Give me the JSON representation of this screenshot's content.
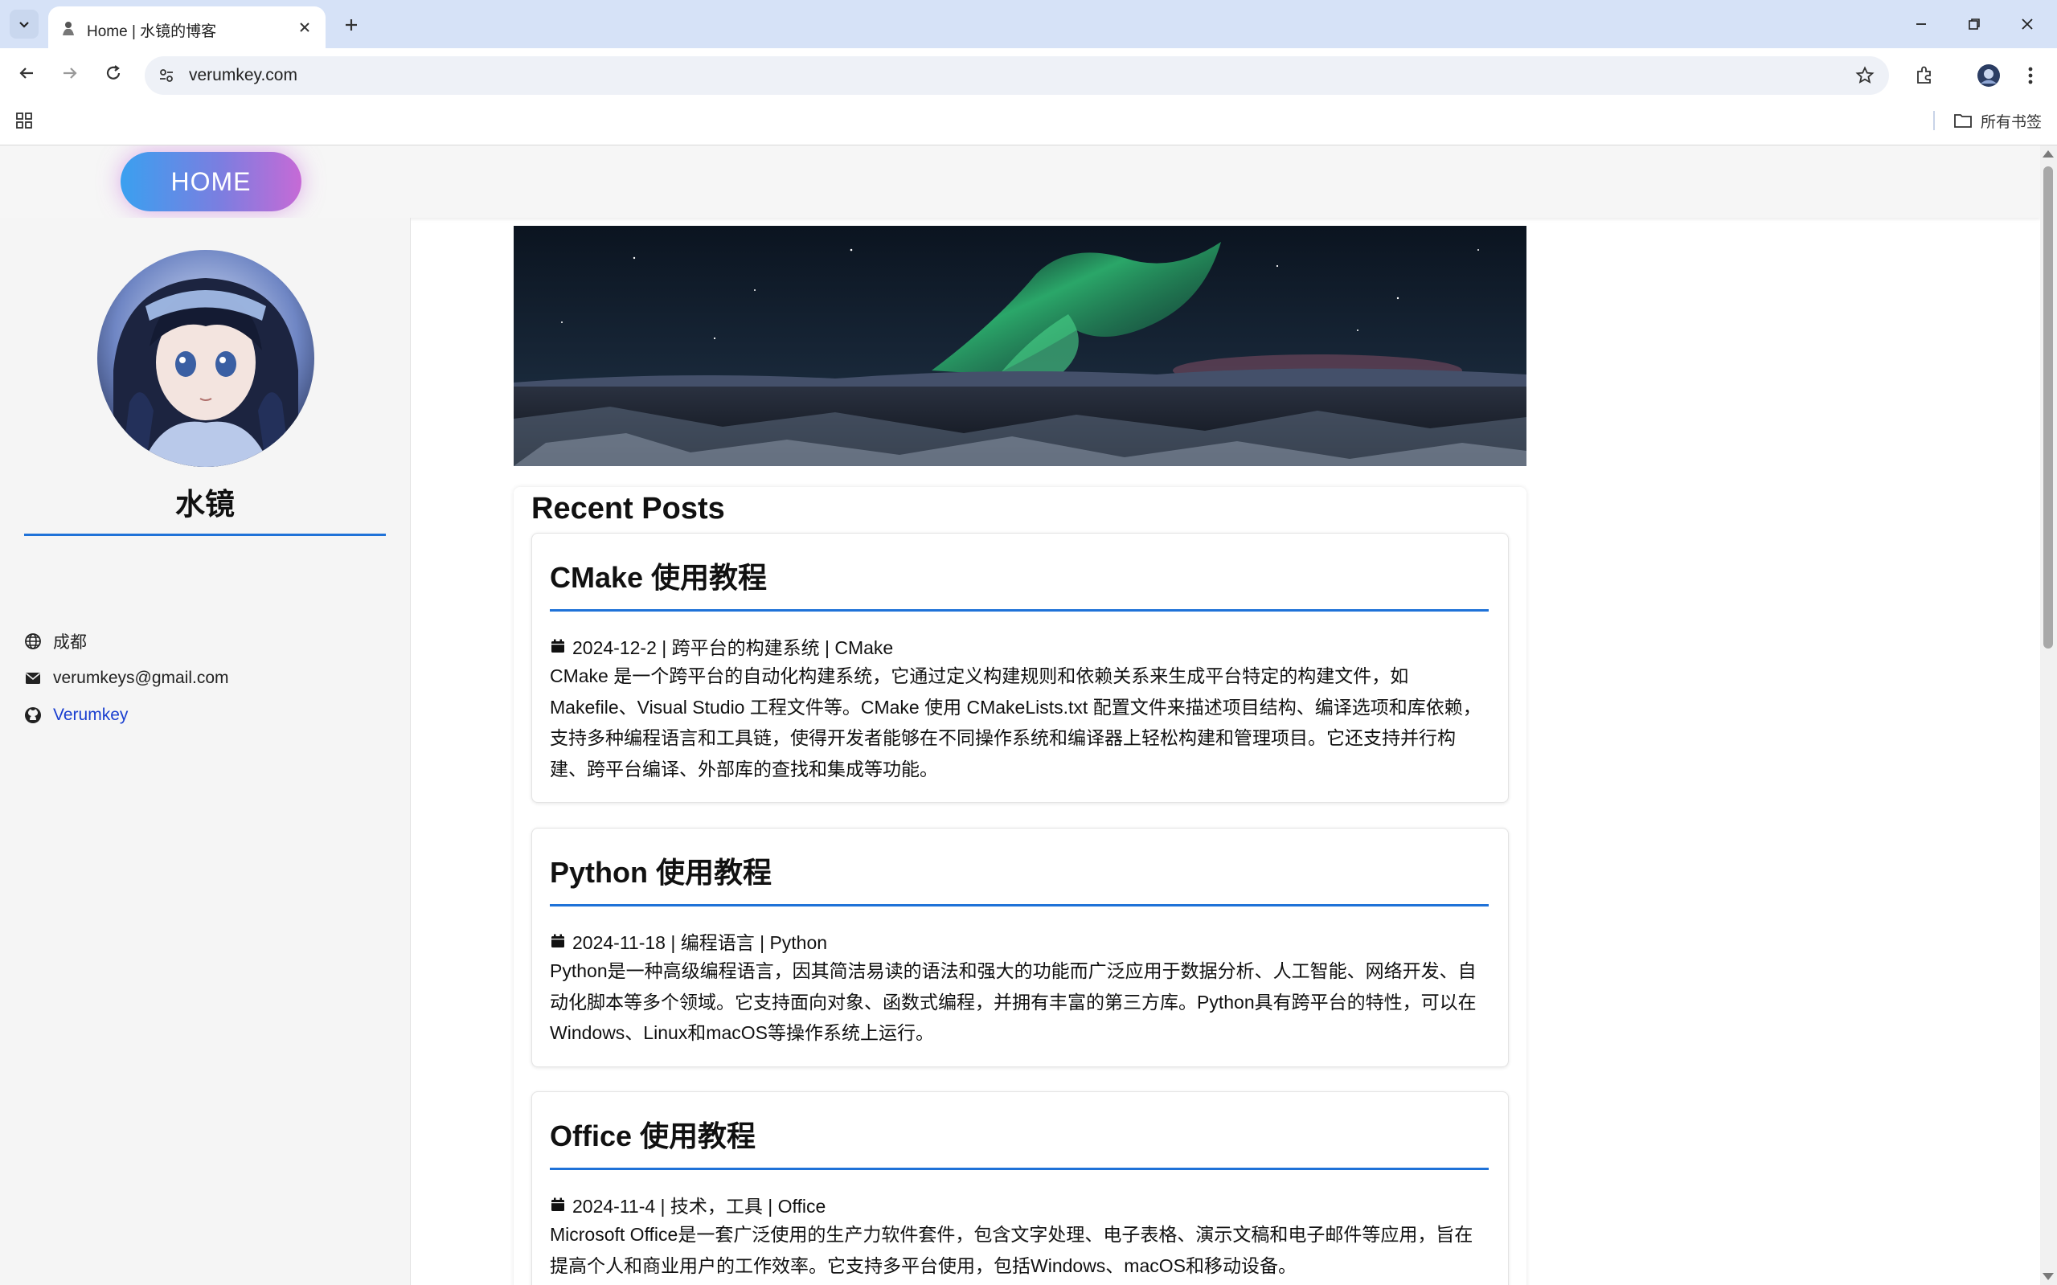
{
  "browser": {
    "tab_title": "Home | 水镜的博客",
    "url": "verumkey.com",
    "bookmarks_folder": "所有书签",
    "icons": [
      "tab-list-icon",
      "close-icon",
      "plus-icon",
      "minimize-icon",
      "restore-icon",
      "back-icon",
      "forward-icon",
      "reload-icon",
      "site-info-icon",
      "star-icon",
      "extensions-icon",
      "profile-avatar",
      "menu-icon",
      "apps-icon",
      "folder-icon"
    ]
  },
  "nav": {
    "home_label": "HOME"
  },
  "sidebar": {
    "name": "水镜",
    "location": "成都",
    "email": "verumkeys@gmail.com",
    "github": "Verumkey"
  },
  "recent": {
    "heading": "Recent Posts",
    "posts": [
      {
        "title": "CMake 使用教程",
        "meta": "2024-12-2 | 跨平台的构建系统 | CMake",
        "desc": "CMake 是一个跨平台的自动化构建系统，它通过定义构建规则和依赖关系来生成平台特定的构建文件，如 Makefile、Visual Studio 工程文件等。CMake 使用 CMakeLists.txt 配置文件来描述项目结构、编译选项和库依赖，支持多种编程语言和工具链，使得开发者能够在不同操作系统和编译器上轻松构建和管理项目。它还支持并行构建、跨平台编译、外部库的查找和集成等功能。"
      },
      {
        "title": "Python 使用教程",
        "meta": "2024-11-18 | 编程语言 | Python",
        "desc": "Python是一种高级编程语言，因其简洁易读的语法和强大的功能而广泛应用于数据分析、人工智能、网络开发、自动化脚本等多个领域。它支持面向对象、函数式编程，并拥有丰富的第三方库。Python具有跨平台的特性，可以在Windows、Linux和macOS等操作系统上运行。"
      },
      {
        "title": "Office 使用教程",
        "meta": "2024-11-4 | 技术，工具 | Office",
        "desc": "Microsoft Office是一套广泛使用的生产力软件套件，包含文字处理、电子表格、演示文稿和电子邮件等应用，旨在提高个人和商业用户的工作效率。它支持多平台使用，包括Windows、macOS和移动设备。"
      }
    ]
  },
  "colors": {
    "accent": "#1f72d8",
    "link": "#1a3fd0",
    "tabstrip": "#d6e2f7"
  }
}
